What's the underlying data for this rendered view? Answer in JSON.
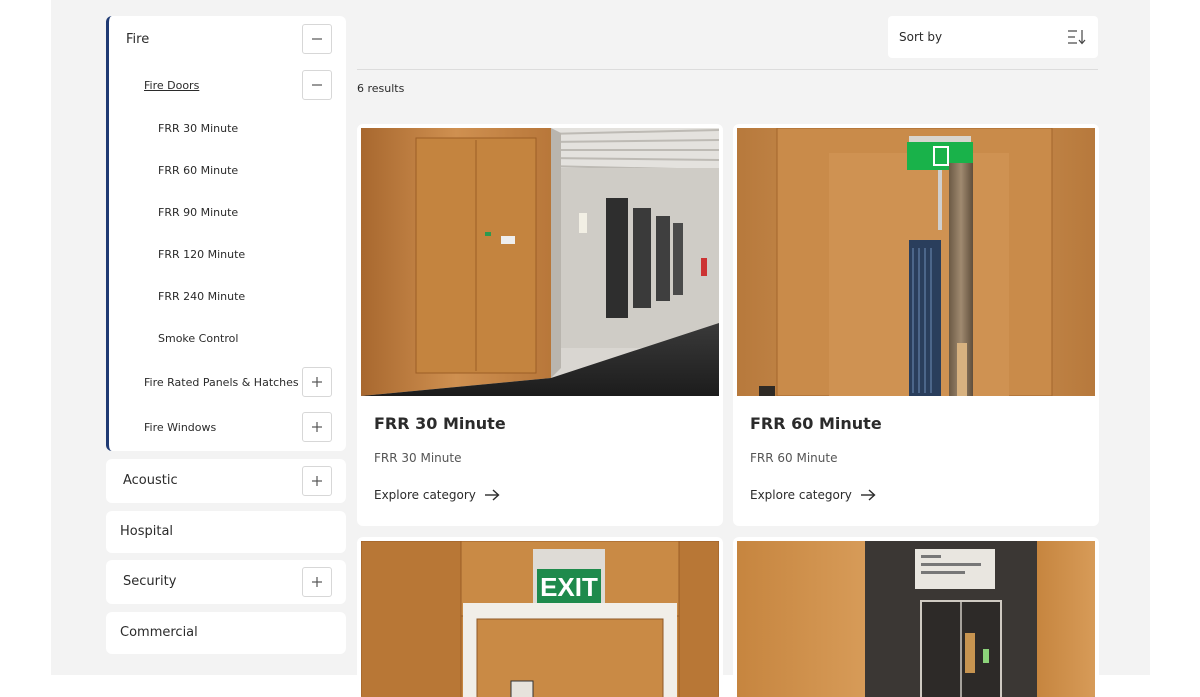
{
  "sidebar": {
    "fire": {
      "label": "Fire",
      "sub": {
        "label": "Fire Doors",
        "items": [
          "FRR 30 Minute",
          "FRR 60 Minute",
          "FRR 90 Minute",
          "FRR 120 Minute",
          "FRR 240 Minute",
          "Smoke Control"
        ]
      },
      "panels_label": "Fire Rated Panels & Hatches",
      "windows_label": "Fire Windows"
    },
    "acoustic": "Acoustic",
    "hospital": "Hospital",
    "security": "Security",
    "commercial": "Commercial"
  },
  "toolbar": {
    "sort_label": "Sort by"
  },
  "results_text": "6 results",
  "cards": [
    {
      "title": "FRR 30 Minute",
      "subtitle": "FRR 30 Minute",
      "link": "Explore category"
    },
    {
      "title": "FRR 60 Minute",
      "subtitle": "FRR 60 Minute",
      "link": "Explore category"
    }
  ],
  "signs": {
    "exit": "EXIT"
  },
  "colors": {
    "accent": "#1f3a73",
    "exit_green": "#1e8a4c",
    "wood": "#c98a48"
  }
}
